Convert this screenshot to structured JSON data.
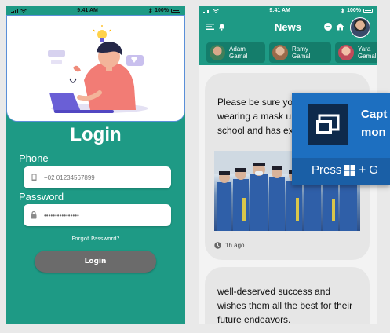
{
  "colors": {
    "teal": "#1e9a85",
    "teal_dark": "#147d6b",
    "button_gray": "#6b6b6b",
    "popup_blue": "#1d6fc0"
  },
  "status_bar": {
    "time": "9:41 AM",
    "battery": "100%"
  },
  "login": {
    "title": "Login",
    "phone_label": "Phone",
    "phone_placeholder": "+02 01234567899",
    "password_label": "Password",
    "password_value": "••••••••••••••••",
    "forgot": "Forgot Password?",
    "button": "Login",
    "icons": [
      "phone-icon",
      "lock-icon"
    ]
  },
  "news": {
    "title": "News",
    "icons": [
      "menu-icon",
      "bell-icon",
      "minus-circle-icon",
      "home-icon",
      "avatar"
    ],
    "stories": [
      {
        "first": "Adam",
        "last": "Gamal",
        "color": "#3f7f5a"
      },
      {
        "first": "Ramy",
        "last": "Gamal",
        "color": "#9a6a4a"
      },
      {
        "first": "Yara",
        "last": "Gamal",
        "color": "#c04a5a"
      }
    ],
    "posts": [
      {
        "lines": [
          "Please be sure yo",
          "wearing a mask u",
          "school and has ex"
        ],
        "time": "1h ago"
      },
      {
        "lines": [
          "well-deserved success and",
          "wishes them all the best for their",
          "future endeavors."
        ]
      }
    ]
  },
  "popup": {
    "title_lines": [
      "Capt",
      "mon"
    ],
    "press": "Press",
    "plus": "+ G"
  }
}
